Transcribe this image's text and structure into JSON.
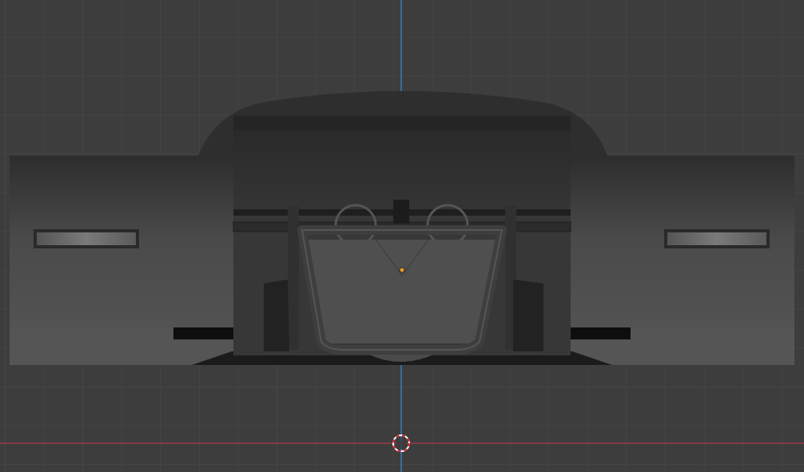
{
  "viewport": {
    "background": "#3d3d3d",
    "grid_color": "#4a4a4a",
    "x_axis_color": "#9a3b46",
    "z_axis_color": "#3f7bb8",
    "origin_color": "#e39a2a",
    "cursor_icon": "3d-cursor-icon",
    "object_origin_icon": "origin-dot-icon"
  }
}
